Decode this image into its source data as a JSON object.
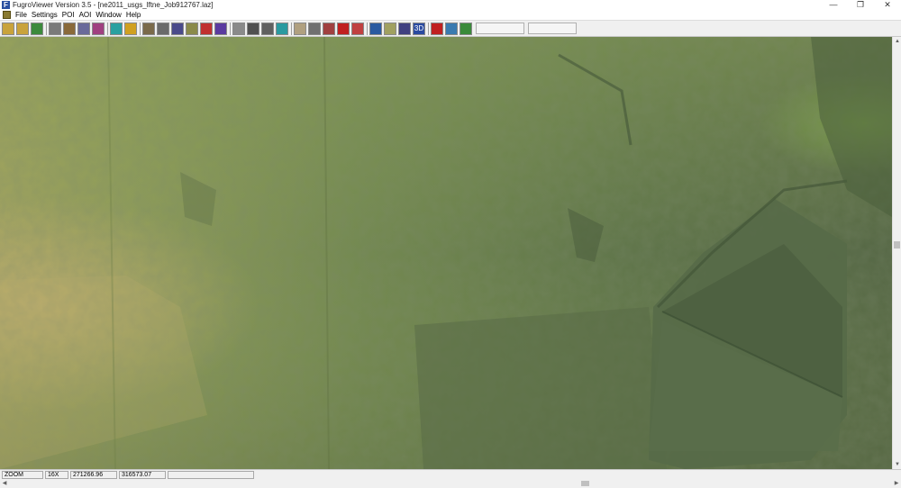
{
  "window": {
    "title": "FugroViewer  Version 3.5 - [ne2011_usgs_lftne_Job912767.laz]",
    "app_icon": "F",
    "minimize": "—",
    "restore": "❐",
    "close": "✕"
  },
  "menubar": {
    "items": [
      "File",
      "Settings",
      "POI",
      "AOI",
      "Window",
      "Help"
    ],
    "underline": [
      "F",
      "S",
      "P",
      "A",
      "W",
      "H"
    ]
  },
  "toolbar": {
    "buttons": [
      {
        "icon": "open-folder-icon",
        "color": "#c9a33c"
      },
      {
        "icon": "open-recent-icon",
        "color": "#c9a33c"
      },
      {
        "icon": "arrow-icon",
        "color": "#3c8a3c"
      },
      {
        "icon": "layers-icon",
        "color": "#7a7a7a"
      },
      {
        "icon": "layers-add-icon",
        "color": "#8a6a3a"
      },
      {
        "icon": "grid-icon",
        "color": "#6a6a9a"
      },
      {
        "icon": "target-icon",
        "color": "#a04080"
      },
      {
        "icon": "surface-icon",
        "color": "#2aa0a0"
      },
      {
        "icon": "bars-icon",
        "color": "#d0a020"
      },
      {
        "icon": "palette-icon",
        "color": "#7a6a4a"
      },
      {
        "icon": "point-cloud-icon",
        "color": "#6a6a6a"
      },
      {
        "icon": "profile-icon",
        "color": "#4a4a8a"
      },
      {
        "icon": "hatch-icon",
        "color": "#8a8a4a"
      },
      {
        "icon": "red-square-icon",
        "color": "#c03030"
      },
      {
        "icon": "rainbow-icon",
        "color": "#5a3aa0"
      },
      {
        "icon": "grid-select-icon",
        "color": "#8a8a8a"
      },
      {
        "icon": "nodes-icon",
        "color": "#505050"
      },
      {
        "icon": "scatter-icon",
        "color": "#606060"
      },
      {
        "icon": "cube-icon",
        "color": "#2a9aa0"
      },
      {
        "icon": "hand-pan-icon",
        "color": "#b0a080"
      },
      {
        "icon": "zoom-icon",
        "color": "#707070"
      },
      {
        "icon": "measure-icon",
        "color": "#a04040"
      },
      {
        "icon": "pin-icon",
        "color": "#c02020"
      },
      {
        "icon": "crosshair-icon",
        "color": "#c04040"
      },
      {
        "icon": "globe-icon",
        "color": "#2a5aa0"
      },
      {
        "icon": "ruler-icon",
        "color": "#a0a060"
      },
      {
        "icon": "pencil-icon",
        "color": "#404080"
      },
      {
        "icon": "3d-icon",
        "color": "#2a4aa0",
        "label": "3D"
      },
      {
        "icon": "stop-icon",
        "color": "#c02020"
      },
      {
        "icon": "sync-icon",
        "color": "#3a7ab0"
      },
      {
        "icon": "export-icon",
        "color": "#3a8a3a"
      }
    ]
  },
  "statusbar": {
    "mode": "ZOOM",
    "zoom": "16X",
    "x": "271266.96",
    "y": "316573.07"
  },
  "scroll": {
    "up": "▲",
    "down": "▼",
    "left": "◀",
    "right": "▶"
  }
}
